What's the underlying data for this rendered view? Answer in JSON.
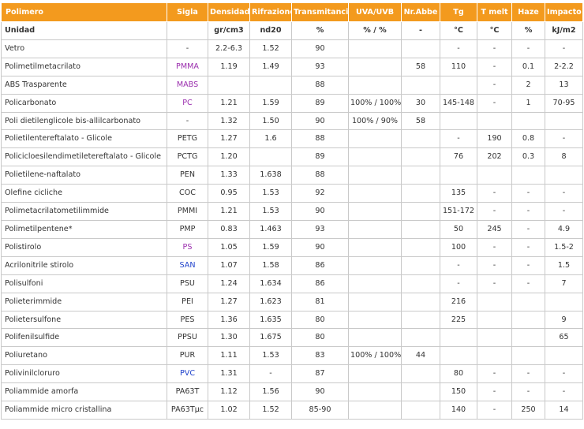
{
  "headers": [
    "Polimero",
    "Sigla",
    "Densidad",
    "Rifrazione",
    "Transmitancia",
    "UVA/UVB",
    "Nr.Abbe",
    "Tg",
    "T melt",
    "Haze",
    "Impacto"
  ],
  "units": [
    "Unidad",
    "",
    "gr/cm3",
    "nd20",
    "%",
    "% / %",
    "-",
    "°C",
    "°C",
    "%",
    "kJ/m2"
  ],
  "colors": {
    "header_bg": "#f39a1e",
    "header_text": "#ffffff",
    "purple": "#9b2fae",
    "blue": "#2244cc",
    "grid": "#c9c9c9"
  },
  "rows": [
    {
      "cells": [
        "Vetro",
        "-",
        "2.2-6.3",
        "1.52",
        "90",
        "",
        "",
        "-",
        "-",
        "-",
        "-"
      ],
      "sigla_color": ""
    },
    {
      "cells": [
        "Polimetilmetacrilato",
        "PMMA",
        "1.19",
        "1.49",
        "93",
        "",
        "58",
        "110",
        "-",
        "0.1",
        "2-2.2"
      ],
      "sigla_color": "purple"
    },
    {
      "cells": [
        "ABS Trasparente",
        "MABS",
        "",
        "",
        "88",
        "",
        "",
        "",
        "-",
        "2",
        "13"
      ],
      "sigla_color": "purple"
    },
    {
      "cells": [
        "Policarbonato",
        "PC",
        "1.21",
        "1.59",
        "89",
        "100% / 100%",
        "30",
        "145-148",
        "-",
        "1",
        "70-95"
      ],
      "sigla_color": "purple"
    },
    {
      "cells": [
        "Poli dietilenglicole bis-allilcarbonato",
        "-",
        "1.32",
        "1.50",
        "90",
        "100% / 90%",
        "58",
        "",
        "",
        "",
        ""
      ],
      "sigla_color": ""
    },
    {
      "cells": [
        "Polietilentereftalato - Glicole",
        "PETG",
        "1.27",
        "1.6",
        "88",
        "",
        "",
        "-",
        "190",
        "0.8",
        "-"
      ],
      "sigla_color": ""
    },
    {
      "cells": [
        "Policicloesilendimetiletereftalato - Glicole",
        "PCTG",
        "1.20",
        "",
        "89",
        "",
        "",
        "76",
        "202",
        "0.3",
        "8"
      ],
      "sigla_color": ""
    },
    {
      "cells": [
        "Polietilene-naftalato",
        "PEN",
        "1.33",
        "1.638",
        "88",
        "",
        "",
        "",
        "",
        "",
        ""
      ],
      "sigla_color": ""
    },
    {
      "cells": [
        "Olefine cicliche",
        "COC",
        "0.95",
        "1.53",
        "92",
        "",
        "",
        "135",
        "-",
        "-",
        "-"
      ],
      "sigla_color": ""
    },
    {
      "cells": [
        "Polimetacrilatometilimmide",
        "PMMI",
        "1.21",
        "1.53",
        "90",
        "",
        "",
        "151-172",
        "-",
        "-",
        "-"
      ],
      "sigla_color": ""
    },
    {
      "cells": [
        "Polimetilpentene*",
        "PMP",
        "0.83",
        "1.463",
        "93",
        "",
        "",
        "50",
        "245",
        "-",
        "4.9"
      ],
      "sigla_color": ""
    },
    {
      "cells": [
        "Polistirolo",
        "PS",
        "1.05",
        "1.59",
        "90",
        "",
        "",
        "100",
        "-",
        "-",
        "1.5-2"
      ],
      "sigla_color": "purple"
    },
    {
      "cells": [
        "Acrilonitrile stirolo",
        "SAN",
        "1.07",
        "1.58",
        "86",
        "",
        "",
        "-",
        "-",
        "-",
        "1.5"
      ],
      "sigla_color": "blue"
    },
    {
      "cells": [
        "Polisulfoni",
        "PSU",
        "1.24",
        "1.634",
        "86",
        "",
        "",
        "-",
        "-",
        "-",
        "7"
      ],
      "sigla_color": ""
    },
    {
      "cells": [
        "Polieterimmide",
        "PEI",
        "1.27",
        "1.623",
        "81",
        "",
        "",
        "216",
        "",
        "",
        ""
      ],
      "sigla_color": ""
    },
    {
      "cells": [
        "Polietersulfone",
        "PES",
        "1.36",
        "1.635",
        "80",
        "",
        "",
        "225",
        "",
        "",
        "9"
      ],
      "sigla_color": ""
    },
    {
      "cells": [
        "Polifenilsulfide",
        "PPSU",
        "1.30",
        "1.675",
        "80",
        "",
        "",
        "",
        "",
        "",
        "65"
      ],
      "sigla_color": ""
    },
    {
      "cells": [
        "Poliuretano",
        "PUR",
        "1.11",
        "1.53",
        "83",
        "100% / 100%",
        "44",
        "",
        "",
        "",
        ""
      ],
      "sigla_color": ""
    },
    {
      "cells": [
        "Polivinilcloruro",
        "PVC",
        "1.31",
        "-",
        "87",
        "",
        "",
        "80",
        "-",
        "-",
        "-"
      ],
      "sigla_color": "blue"
    },
    {
      "cells": [
        "Poliammide amorfa",
        "PA63T",
        "1.12",
        "1.56",
        "90",
        "",
        "",
        "150",
        "-",
        "-",
        "-"
      ],
      "sigla_color": ""
    },
    {
      "cells": [
        "Poliammide micro cristallina",
        "PA63Tμc",
        "1.02",
        "1.52",
        "85-90",
        "",
        "",
        "140",
        "-",
        "250",
        "14"
      ],
      "sigla_color": ""
    }
  ]
}
